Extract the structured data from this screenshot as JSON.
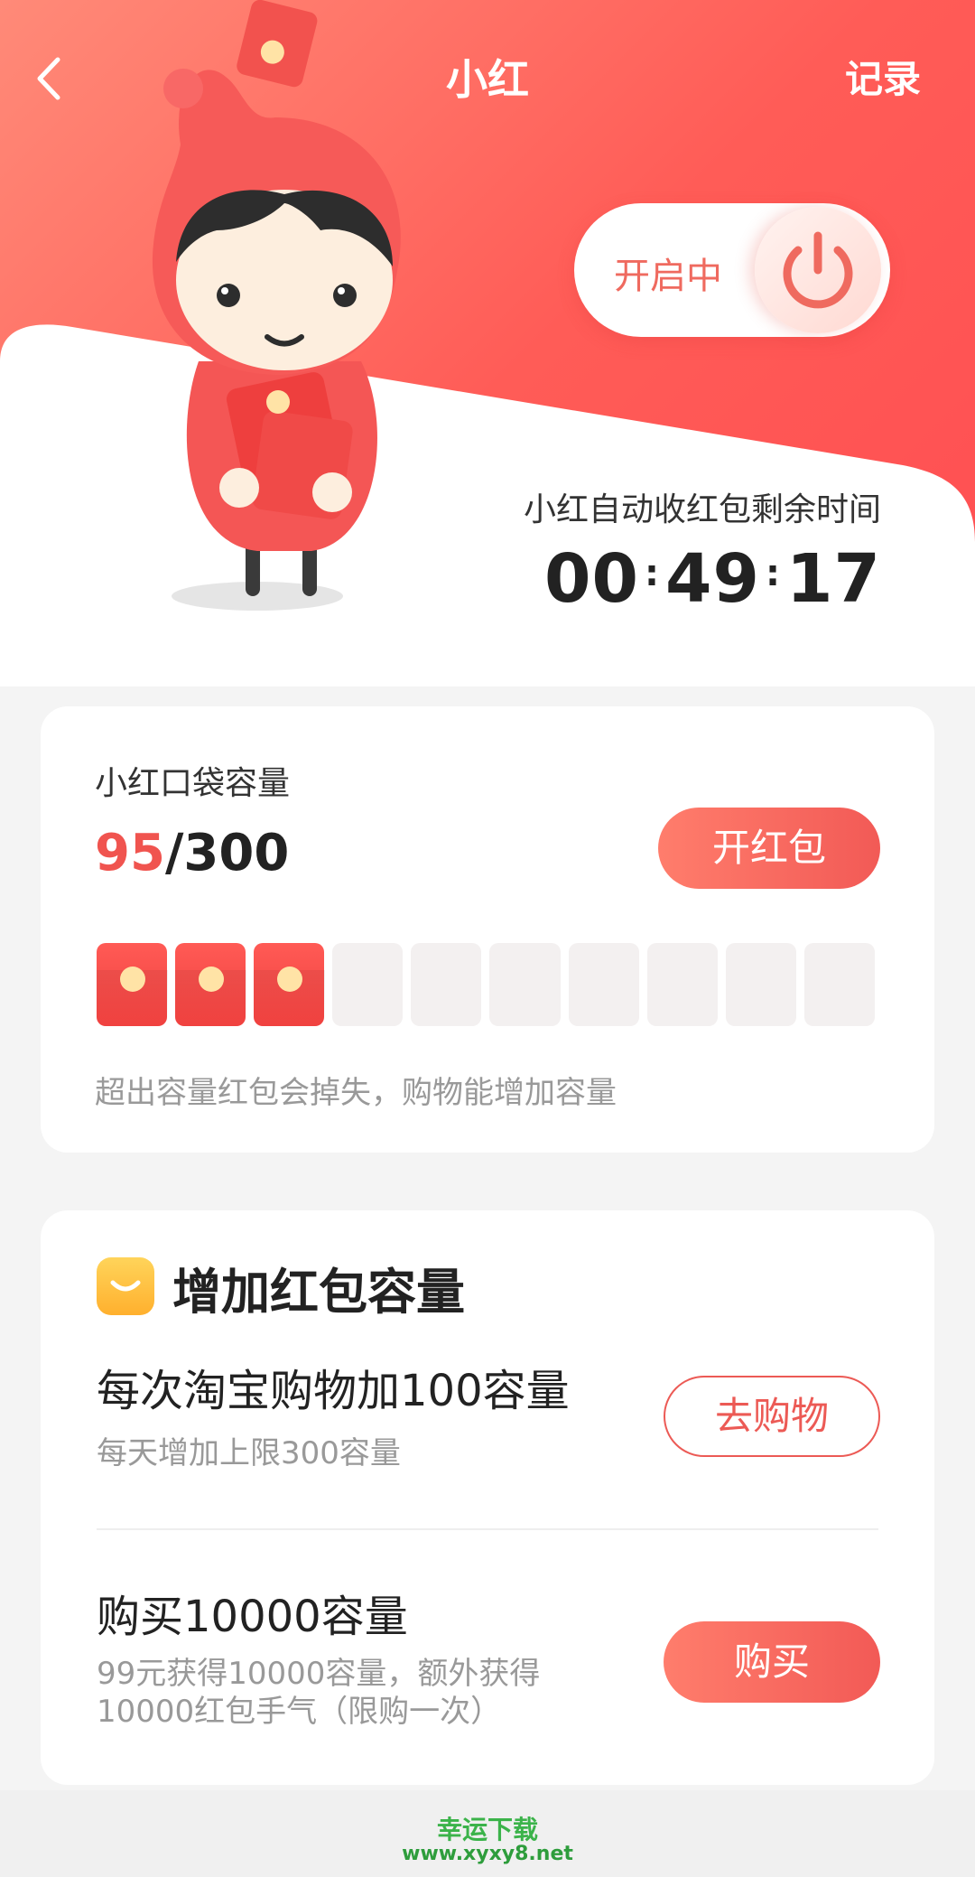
{
  "header": {
    "title": "小红",
    "record_label": "记录",
    "toggle_label": "开启中"
  },
  "timer": {
    "label": "小红自动收红包剩余时间",
    "hours": "00",
    "minutes": "49",
    "seconds": "17"
  },
  "capacity": {
    "label": "小红口袋容量",
    "current": "95",
    "total": "/300",
    "open_button": "开红包",
    "slots_total": 10,
    "slots_filled": 3,
    "note": "超出容量红包会掉失，购物能增加容量"
  },
  "increase": {
    "title": "增加红包容量",
    "items": [
      {
        "title": "每次淘宝购物加100容量",
        "subtitle": "每天增加上限300容量",
        "button": "去购物"
      },
      {
        "title": "购买10000容量",
        "subtitle_line1": "99元获得10000容量，额外获得",
        "subtitle_line2": "10000红包手气（限购一次）",
        "button": "购买"
      }
    ]
  },
  "watermark": {
    "name": "幸运下载",
    "url": "www.xyxy8.net"
  },
  "colors": {
    "accent": "#f25a56",
    "header_gradient_start": "#ff8a78",
    "header_gradient_end": "#ff4f52"
  }
}
